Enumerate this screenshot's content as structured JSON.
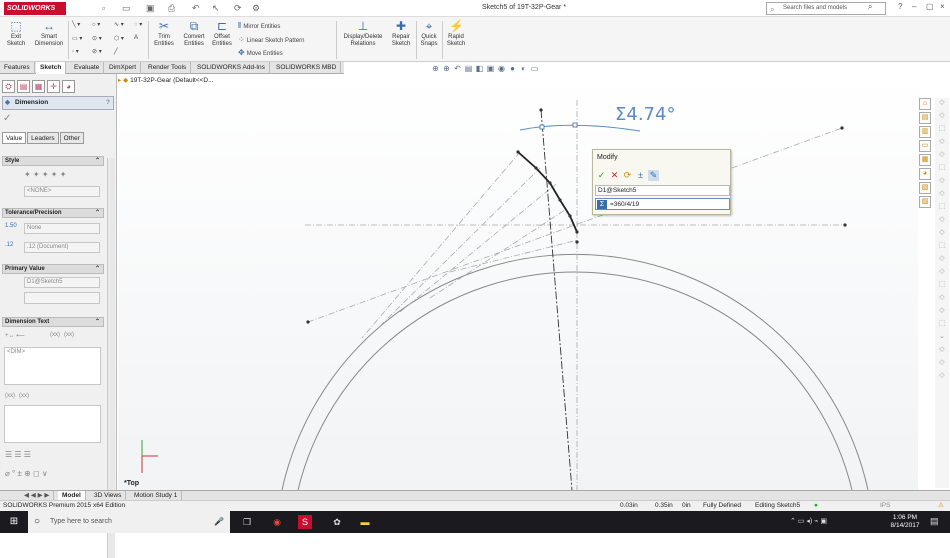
{
  "app": {
    "logo": "SOLIDWORKS",
    "doc_title": "Sketch5 of 19T-32P-Gear *"
  },
  "search": {
    "placeholder": "Search files and models"
  },
  "ribbon": {
    "exit_sketch": "Exit Sketch",
    "smart_dimension": "Smart Dimension",
    "trim_entities": "Trim Entities",
    "convert_entities": "Convert Entities",
    "offset_entities": "Offset Entities",
    "mirror_entities": "Mirror Entities",
    "linear_pattern": "Linear Sketch Pattern",
    "move_entities": "Move Entities",
    "display_delete_relations": "Display/Delete Relations",
    "repair_sketch": "Repair Sketch",
    "quick_snaps": "Quick Snaps",
    "rapid_sketch": "Rapid Sketch"
  },
  "tabs": [
    "Features",
    "Sketch",
    "Evaluate",
    "DimXpert",
    "Render Tools",
    "SOLIDWORKS Add-Ins",
    "SOLIDWORKS MBD"
  ],
  "active_tab": "Sketch",
  "property_manager": {
    "title": "Dimension",
    "subtabs": [
      "Value",
      "Leaders",
      "Other"
    ],
    "groups": {
      "style": "Style",
      "style_value": "<NONE>",
      "tolerance": "Tolerance/Precision",
      "tolerance_value": "None",
      "precision_value": ".12 (Document)",
      "primary_value": "Primary Value",
      "primary_name": "D1@Sketch5",
      "dimension_text": "Dimension Text",
      "dim_placeholder": "<DIM>",
      "xx1": "(xx)",
      "xx2": "(xx)",
      "xx3": "(xx)",
      "xx4": "(xx)",
      "tol_icon1": "1.50",
      "tol_icon2": ".12"
    }
  },
  "tree": {
    "root": "19T-32P-Gear  (Default<<D..."
  },
  "modify_dialog": {
    "title": "Modify",
    "name": "D1@Sketch5",
    "value": "=360/4/19"
  },
  "dimension_label": "Σ4.74°",
  "view_name": "*Top",
  "bottom_tabs": [
    "Model",
    "3D Views",
    "Motion Study 1"
  ],
  "status": {
    "edition": "SOLIDWORKS Premium 2015 x64 Edition",
    "x": "0.03in",
    "y": "0.35in",
    "z": "0in",
    "state": "Fully Defined",
    "editing": "Editing Sketch5",
    "units": "IPS"
  },
  "taskbar": {
    "search_placeholder": "Type here to search",
    "time": "1:06 PM",
    "date": "8/14/2017"
  }
}
